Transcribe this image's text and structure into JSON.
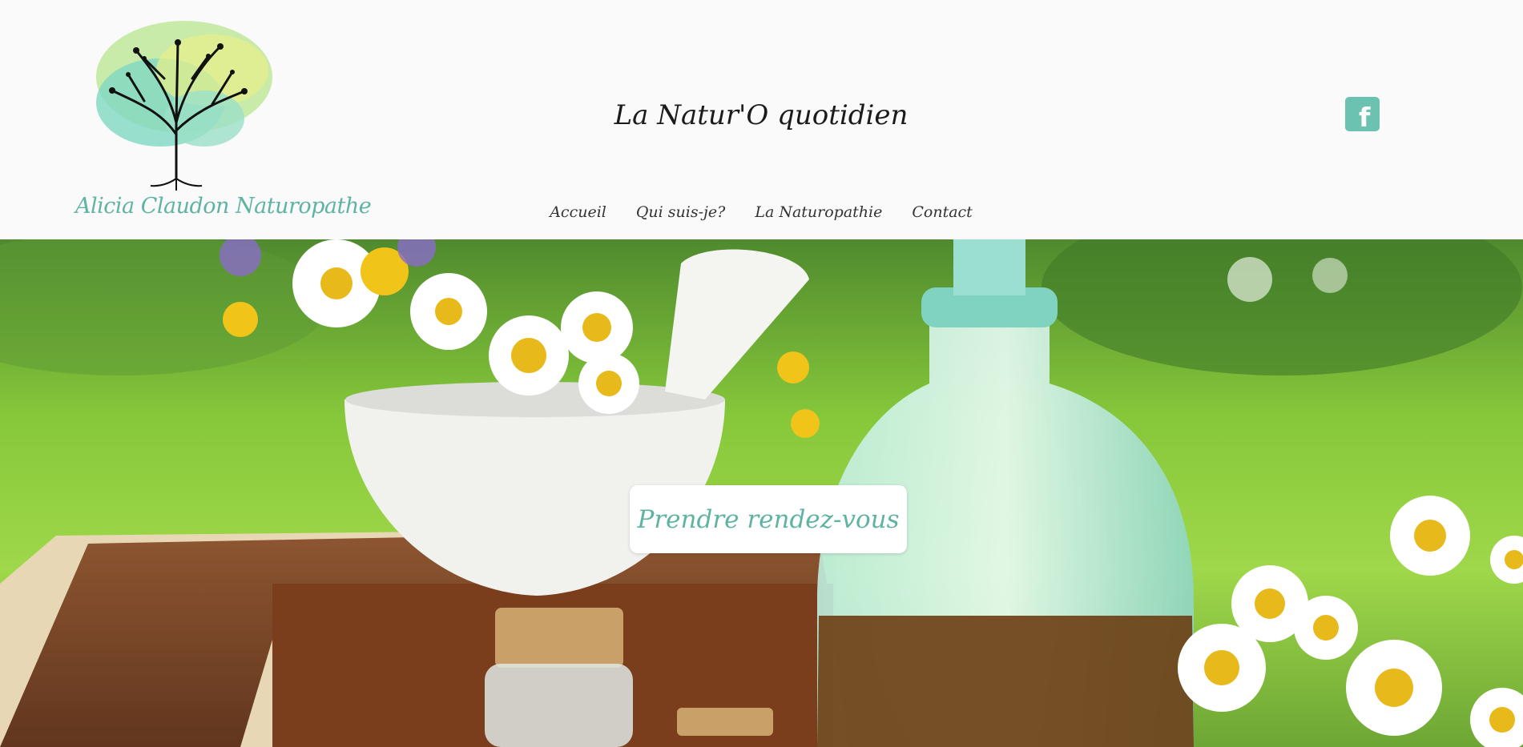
{
  "logo": {
    "caption": "Alicia Claudon Naturopathe",
    "icon": "tree-icon"
  },
  "site_title": "La Natur'O quotidien",
  "social": {
    "facebook_icon": "facebook-icon",
    "facebook_glyph": "f"
  },
  "nav": {
    "items": [
      {
        "label": "Accueil"
      },
      {
        "label": "Qui suis-je?"
      },
      {
        "label": "La Naturopathie"
      },
      {
        "label": "Contact"
      }
    ]
  },
  "hero": {
    "cta_label": "Prendre rendez-vous"
  },
  "colors": {
    "accent": "#5fb3a2",
    "facebook": "#6cc2b0",
    "title": "#1b1b1b"
  }
}
